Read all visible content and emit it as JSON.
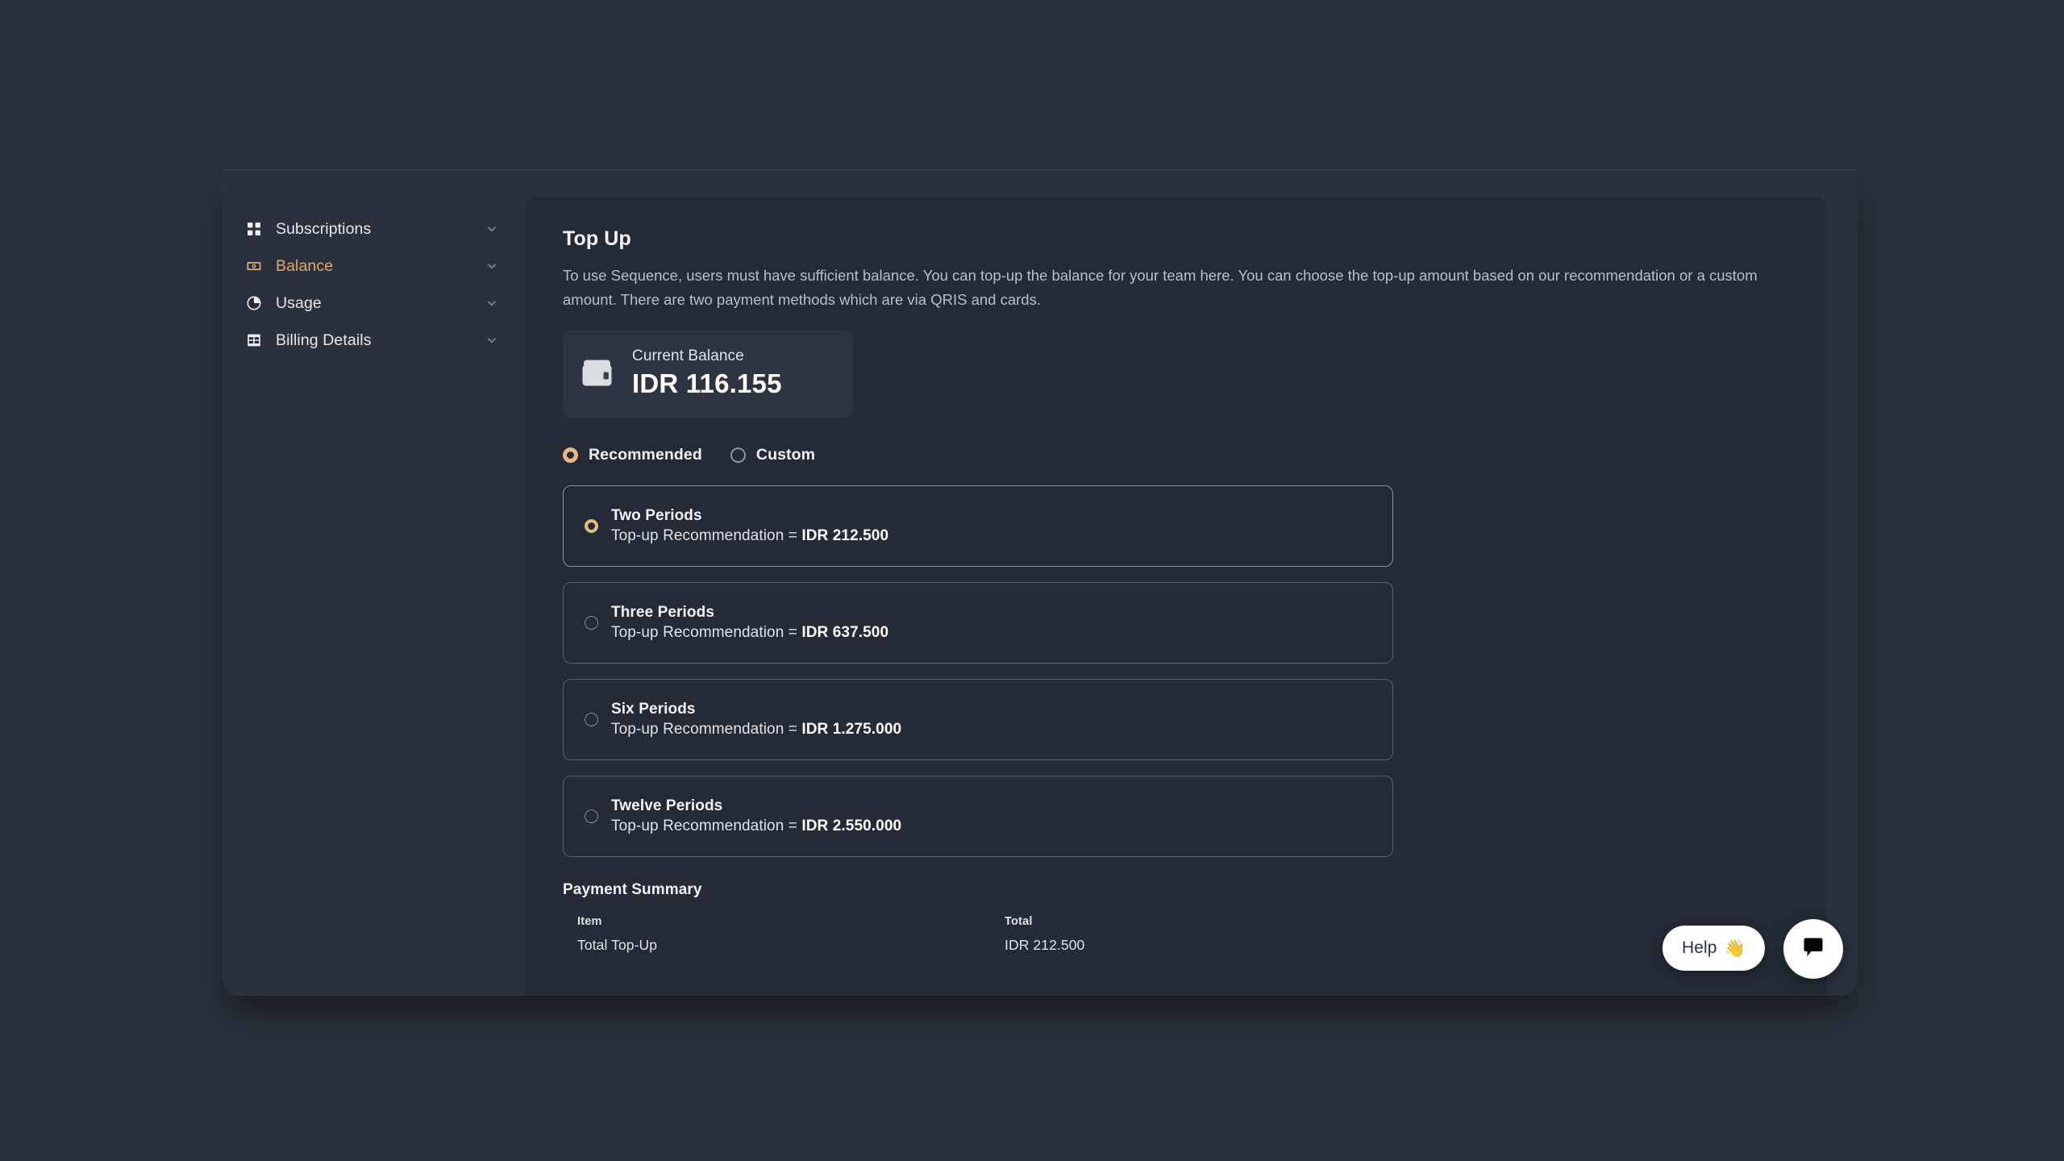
{
  "sidebar": {
    "items": [
      {
        "label": "Subscriptions",
        "icon": "grid-icon",
        "active": false,
        "chevron": "chevron-down-icon"
      },
      {
        "label": "Balance",
        "icon": "banknote-icon",
        "active": true,
        "chevron": "chevron-down-icon"
      },
      {
        "label": "Usage",
        "icon": "pie-chart-icon",
        "active": false,
        "chevron": "chevron-down-icon"
      },
      {
        "label": "Billing Details",
        "icon": "table-icon",
        "active": false,
        "chevron": "chevron-down-icon"
      }
    ]
  },
  "main": {
    "title": "Top Up",
    "description": "To use Sequence, users must have sufficient balance. You can top-up the balance for your team here. You can choose the top-up amount based on our recommendation or a custom amount. There are two payment methods which are via QRIS and cards.",
    "balance_card": {
      "icon": "wallet-icon",
      "label": "Current Balance",
      "value": "IDR 116.155"
    },
    "mode_options": [
      {
        "label": "Recommended",
        "selected": true
      },
      {
        "label": "Custom",
        "selected": false
      }
    ],
    "recommendation_prefix": "Top-up Recommendation = ",
    "options": [
      {
        "title": "Two Periods",
        "amount": "IDR 212.500",
        "selected": true
      },
      {
        "title": "Three Periods",
        "amount": "IDR 637.500",
        "selected": false
      },
      {
        "title": "Six Periods",
        "amount": "IDR 1.275.000",
        "selected": false
      },
      {
        "title": "Twelve Periods",
        "amount": "IDR 2.550.000",
        "selected": false
      }
    ],
    "payment_summary": {
      "title": "Payment Summary",
      "headers": {
        "item": "Item",
        "total": "Total"
      },
      "rows": [
        {
          "item": "Total Top-Up",
          "total": "IDR 212.500"
        }
      ]
    }
  },
  "widgets": {
    "help": {
      "label": "Help",
      "emoji": "👋"
    },
    "chat": {
      "icon": "chat-bubble-icon"
    }
  },
  "colors": {
    "page_background": "#2a313c",
    "card_background": "#242b36",
    "balance_card_background": "#2d3542",
    "accent": "#e0a96d",
    "radio_accent": "#e5b887",
    "border": "#59616d",
    "text_primary": "#f2f4f7",
    "text_secondary": "#b9bfc9"
  }
}
